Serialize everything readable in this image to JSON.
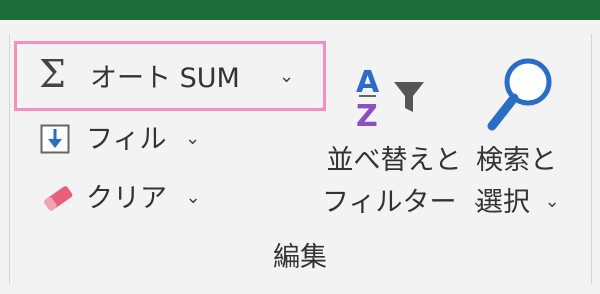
{
  "ribbon": {
    "group_label": "編集",
    "autosum": {
      "label": "オート SUM",
      "chevron": "⌄",
      "icon": "sigma-icon"
    },
    "fill": {
      "label": "フィル",
      "chevron": "⌄",
      "icon": "fill-down-icon"
    },
    "clear": {
      "label": "クリア",
      "chevron": "⌄",
      "icon": "eraser-icon"
    },
    "sort_filter": {
      "label_line1": "並べ替えと",
      "label_line2": "フィルター",
      "chevron": "⌄",
      "icon": "sort-filter-icon"
    },
    "find_select": {
      "label_line1": "検索と",
      "label_line2": "選択",
      "chevron": "⌄",
      "icon": "magnifier-icon"
    }
  },
  "colors": {
    "titlebar": "#1e6b3b",
    "highlight_border": "#f48fbf",
    "accent_blue": "#2b6cc4",
    "eraser_pink": "#e8617a",
    "sort_purple": "#8a4fc4"
  }
}
